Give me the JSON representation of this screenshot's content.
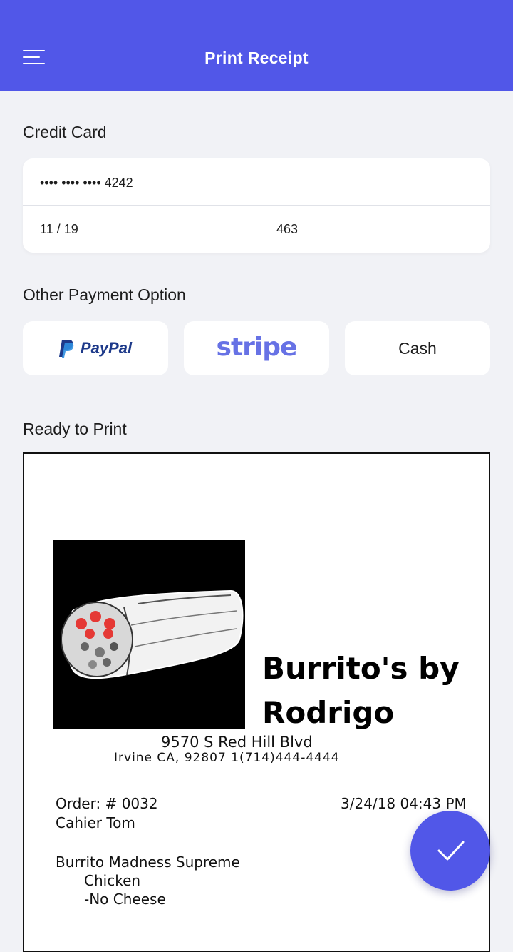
{
  "header": {
    "title": "Print Receipt"
  },
  "credit_card": {
    "section_label": "Credit Card",
    "number": "•••• •••• •••• 4242",
    "expiry": "11 / 19",
    "cvc": "463"
  },
  "other_payment": {
    "section_label": "Other Payment Option",
    "options": [
      {
        "label": "PayPal",
        "icon": "paypal-logo-icon"
      },
      {
        "label": "stripe",
        "icon": "stripe-logo"
      },
      {
        "label": "Cash"
      }
    ]
  },
  "receipt": {
    "section_label": "Ready to Print",
    "store_name_line1": "Burrito's by",
    "store_name_line2": "Rodrigo",
    "address_line1": "9570 S Red Hill Blvd",
    "address_line2": "Irvine CA, 92807 1(714)444-4444",
    "order": "Order: # 0032",
    "datetime": "3/24/18 04:43 PM",
    "cashier": "Cahier Tom",
    "item_name": "Burrito Madness Supreme",
    "item_option1": "Chicken",
    "item_option2": "-No Cheese"
  },
  "fab": {
    "icon": "checkmark-icon"
  },
  "colors": {
    "accent": "#5157e8",
    "background": "#f1f2f6",
    "paypal_dark": "#1e3a8a",
    "paypal_light": "#2f8fe0",
    "stripe": "#6772e5"
  }
}
